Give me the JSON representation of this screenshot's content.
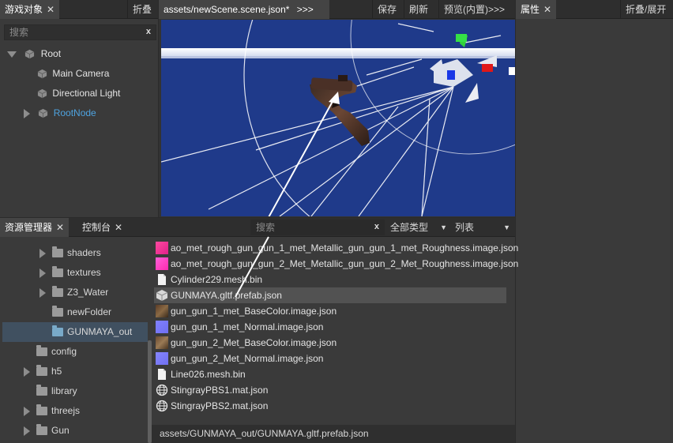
{
  "hierarchy": {
    "tab_label": "游戏对象",
    "fold_label": "折叠",
    "search_placeholder": "搜索",
    "clear_label": "x",
    "items": [
      {
        "label": "Root",
        "icon": "cube-icon",
        "expanded": true
      },
      {
        "label": "Main Camera",
        "icon": "cube-icon"
      },
      {
        "label": "Directional Light",
        "icon": "cube-icon"
      },
      {
        "label": "RootNode",
        "icon": "cube-icon",
        "collapsed": true,
        "color": "#4ea3e0"
      }
    ]
  },
  "scene": {
    "tab_label": "assets/newScene.scene.json*",
    "more_label": ">>>",
    "save_label": "保存",
    "refresh_label": "刷新",
    "preview_label": "预览(内置)>>>",
    "sky_color": "#1f3a8a"
  },
  "inspector": {
    "tab_label": "属性",
    "toggle_label": "折叠/展开"
  },
  "assets": {
    "tab_label": "资源管理器",
    "console_label": "控制台",
    "search_placeholder": "搜索",
    "clear_label": "x",
    "type_filter": "全部类型",
    "view_mode": "列表",
    "folders": [
      {
        "label": "shaders",
        "indent": 2,
        "arrow": true
      },
      {
        "label": "textures",
        "indent": 2,
        "arrow": true
      },
      {
        "label": "Z3_Water",
        "indent": 2,
        "arrow": true
      },
      {
        "label": "newFolder",
        "indent": 2,
        "arrow": false
      },
      {
        "label": "GUNMAYA_out",
        "indent": 2,
        "arrow": false,
        "selected": true
      },
      {
        "label": "config",
        "indent": 1,
        "arrow": false
      },
      {
        "label": "h5",
        "indent": 1,
        "arrow": true
      },
      {
        "label": "library",
        "indent": 1,
        "arrow": false
      },
      {
        "label": "threejs",
        "indent": 1,
        "arrow": true
      },
      {
        "label": "Gun",
        "indent": 1,
        "arrow": true
      }
    ],
    "files": [
      {
        "label": "ao_met_rough_gun_gun_1_met_Metallic_gun_gun_1_met_Roughness.image.json",
        "icon": "texture-magenta-icon"
      },
      {
        "label": "ao_met_rough_gun_gun_2_Met_Metallic_gun_gun_2_Met_Roughness.image.json",
        "icon": "texture-pink-icon"
      },
      {
        "label": "Cylinder229.mesh.bin",
        "icon": "file-icon"
      },
      {
        "label": "GUNMAYA.gltf.prefab.json",
        "icon": "prefab-cube-icon",
        "selected": true
      },
      {
        "label": "gun_gun_1_met_BaseColor.image.json",
        "icon": "texture-brown-icon"
      },
      {
        "label": "gun_gun_1_met_Normal.image.json",
        "icon": "texture-normal-icon"
      },
      {
        "label": "gun_gun_2_Met_BaseColor.image.json",
        "icon": "texture-brown-icon"
      },
      {
        "label": "gun_gun_2_Met_Normal.image.json",
        "icon": "texture-normal-icon"
      },
      {
        "label": "Line026.mesh.bin",
        "icon": "file-icon"
      },
      {
        "label": "StingrayPBS1.mat.json",
        "icon": "globe-icon"
      },
      {
        "label": "StingrayPBS2.mat.json",
        "icon": "globe-icon"
      }
    ],
    "status_path": "assets/GUNMAYA_out/GUNMAYA.gltf.prefab.json"
  }
}
